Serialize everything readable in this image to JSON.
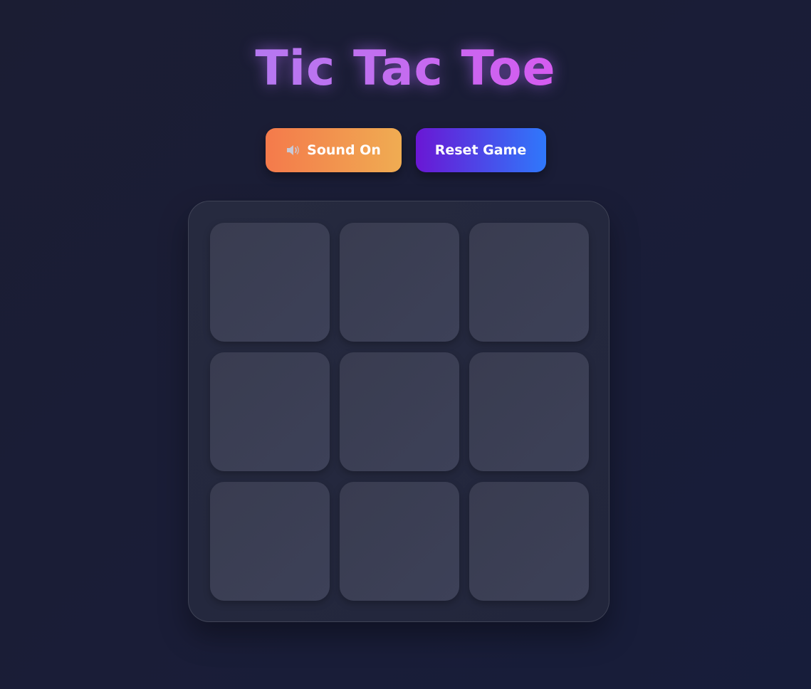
{
  "title": "Tic Tac Toe",
  "controls": {
    "sound_label": "Sound On",
    "sound_icon": "speaker-icon",
    "reset_label": "Reset Game"
  },
  "board": {
    "cells": [
      "",
      "",
      "",
      "",
      "",
      "",
      "",
      "",
      ""
    ]
  },
  "colors": {
    "background": "#1a1d36",
    "title_gradient_start": "#9b8cf3",
    "title_gradient_end": "#f23ff0",
    "sound_button_start": "#f47a4b",
    "sound_button_end": "#f0ac52",
    "reset_button_start": "#6a17d4",
    "reset_button_end": "#2f78fb",
    "board_bg": "#252940",
    "cell_bg": "#3b3f54"
  }
}
